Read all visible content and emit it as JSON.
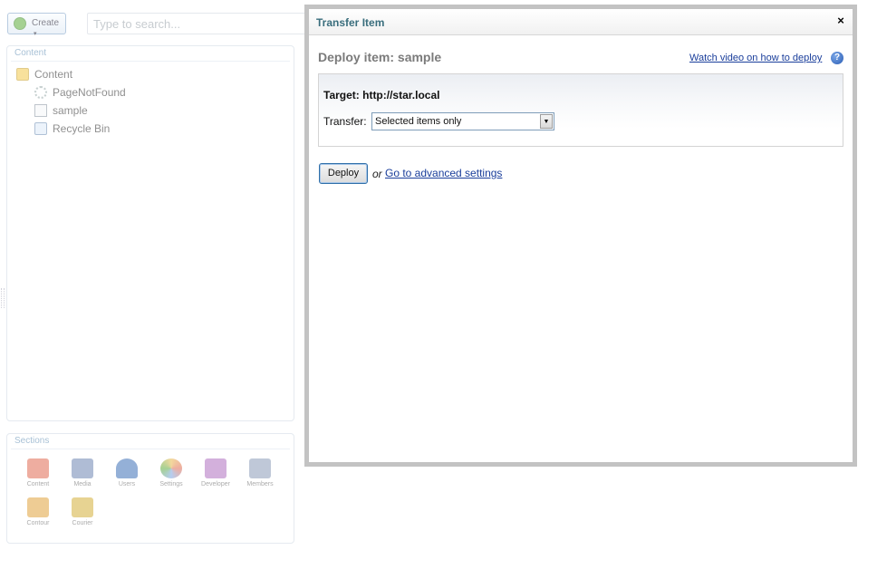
{
  "toolbar": {
    "create_label": "Create",
    "create_caret": "▾",
    "search_placeholder": "Type to search..."
  },
  "content_panel": {
    "title": "Content",
    "tree": [
      {
        "label": "Content",
        "icon": "folder-icon"
      },
      {
        "label": "PageNotFound",
        "icon": "gear-icon"
      },
      {
        "label": "sample",
        "icon": "document-icon"
      },
      {
        "label": "Recycle Bin",
        "icon": "recycle-bin-icon"
      }
    ]
  },
  "sections_panel": {
    "title": "Sections",
    "items": [
      {
        "label": "Content",
        "icon": "content-section-icon",
        "color": "#e06a52"
      },
      {
        "label": "Media",
        "icon": "media-section-icon",
        "color": "#6d86b3"
      },
      {
        "label": "Users",
        "icon": "users-section-icon",
        "color": "#3c6fb6"
      },
      {
        "label": "Settings",
        "icon": "settings-section-icon",
        "color": "#e8b84d"
      },
      {
        "label": "Developer",
        "icon": "developer-section-icon",
        "color": "#b06fc0"
      },
      {
        "label": "Members",
        "icon": "members-section-icon",
        "color": "#8a9bb8"
      },
      {
        "label": "Contour",
        "icon": "contour-section-icon",
        "color": "#e0a33c"
      },
      {
        "label": "Courier",
        "icon": "courier-section-icon",
        "color": "#d4b03a"
      }
    ]
  },
  "modal": {
    "title": "Transfer Item",
    "close": "×",
    "heading": "Deploy item: sample",
    "help_link": "Watch video on how to deploy",
    "help_icon": "?",
    "target": "Target: http://star.local",
    "transfer_label": "Transfer:",
    "transfer_value": "Selected items only",
    "select_arrow": "▼",
    "deploy_button": "Deploy",
    "or_text": "or",
    "advanced_link": "Go to advanced settings"
  }
}
